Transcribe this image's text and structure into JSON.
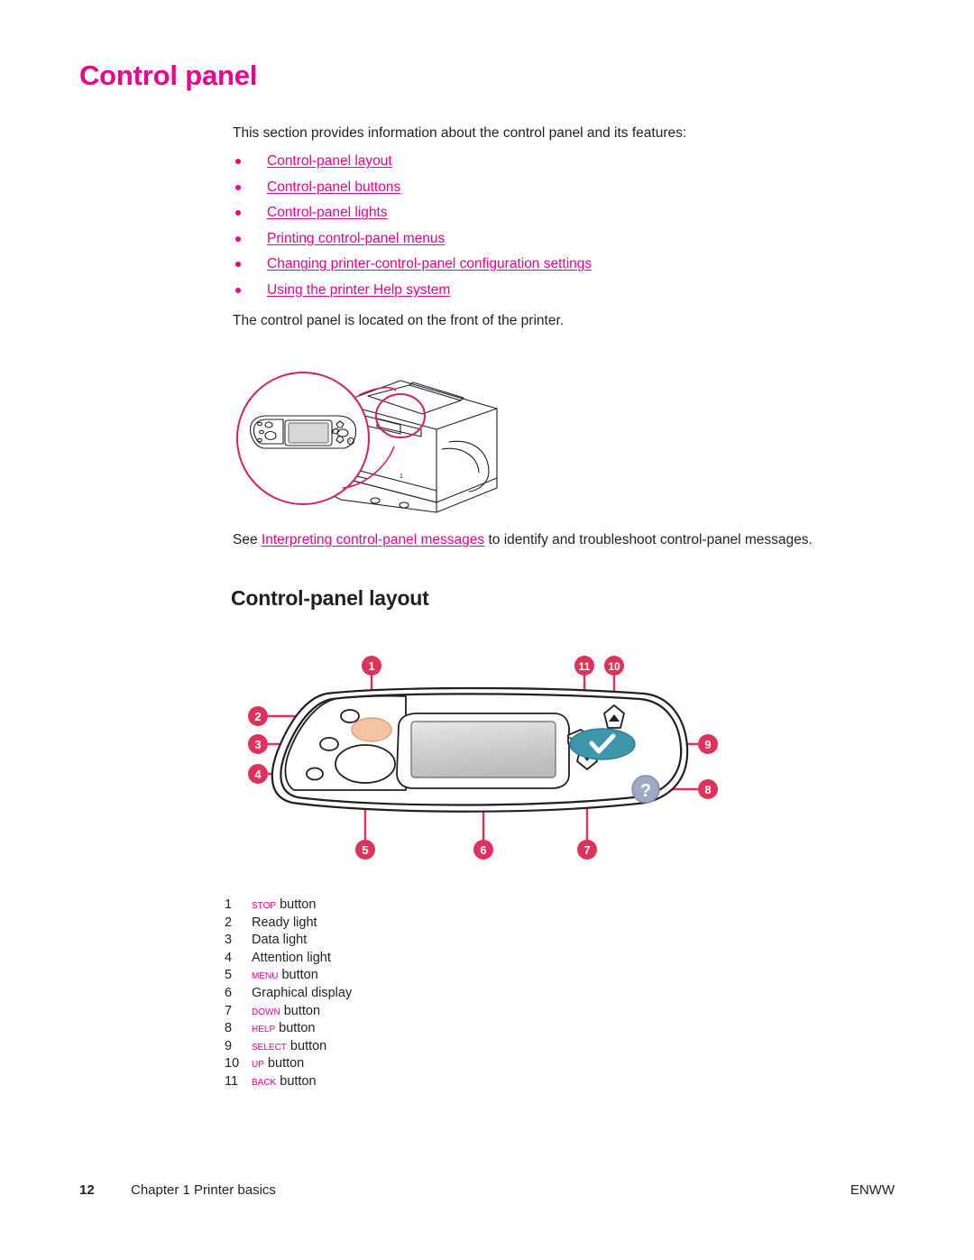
{
  "title": "Control panel",
  "intro": "This section provides information about the control panel and its features:",
  "links": [
    {
      "label": "Control-panel layout"
    },
    {
      "label": "Control-panel buttons"
    },
    {
      "label": "Control-panel lights"
    },
    {
      "label": "Printing control-panel menus"
    },
    {
      "label": "Changing printer-control-panel configuration settings"
    },
    {
      "label": "Using the printer Help system"
    }
  ],
  "location_note": "The control panel is located on the front of the printer.",
  "see_line": {
    "prefix": "See ",
    "link": "Interpreting control-panel messages",
    "suffix": " to identify and troubleshoot control-panel messages."
  },
  "section_heading": "Control-panel layout",
  "callouts": {
    "n1": "1",
    "n2": "2",
    "n3": "3",
    "n4": "4",
    "n5": "5",
    "n6": "6",
    "n7": "7",
    "n8": "8",
    "n9": "9",
    "n10": "10",
    "n11": "11"
  },
  "help_glyph": "?",
  "legend": [
    {
      "num": "1",
      "name": "Stop",
      "rest": " button",
      "styled": true
    },
    {
      "num": "2",
      "name": "",
      "rest": "Ready light",
      "styled": false
    },
    {
      "num": "3",
      "name": "",
      "rest": "Data light",
      "styled": false
    },
    {
      "num": "4",
      "name": "",
      "rest": "Attention light",
      "styled": false
    },
    {
      "num": "5",
      "name": "Menu",
      "rest": " button",
      "styled": true
    },
    {
      "num": "6",
      "name": "",
      "rest": "Graphical display",
      "styled": false
    },
    {
      "num": "7",
      "name": "Down",
      "rest": " button",
      "styled": true
    },
    {
      "num": "8",
      "name": "Help",
      "rest": " button",
      "styled": true
    },
    {
      "num": "9",
      "name": "Select",
      "rest": " button",
      "styled": true
    },
    {
      "num": "10",
      "name": "Up",
      "rest": " button",
      "styled": true
    },
    {
      "num": "11",
      "name": "Back",
      "rest": " button",
      "styled": true
    }
  ],
  "footer": {
    "page_number": "12",
    "chapter": "Chapter 1  Printer basics",
    "right": "ENWW"
  },
  "colors": {
    "magenta": "#ec008c",
    "callout_red": "#e0315b",
    "select_teal": "#3f95aa",
    "help_gray": "#9fa8c4",
    "stop_peach": "#f6c3a2",
    "text": "#231f20"
  }
}
